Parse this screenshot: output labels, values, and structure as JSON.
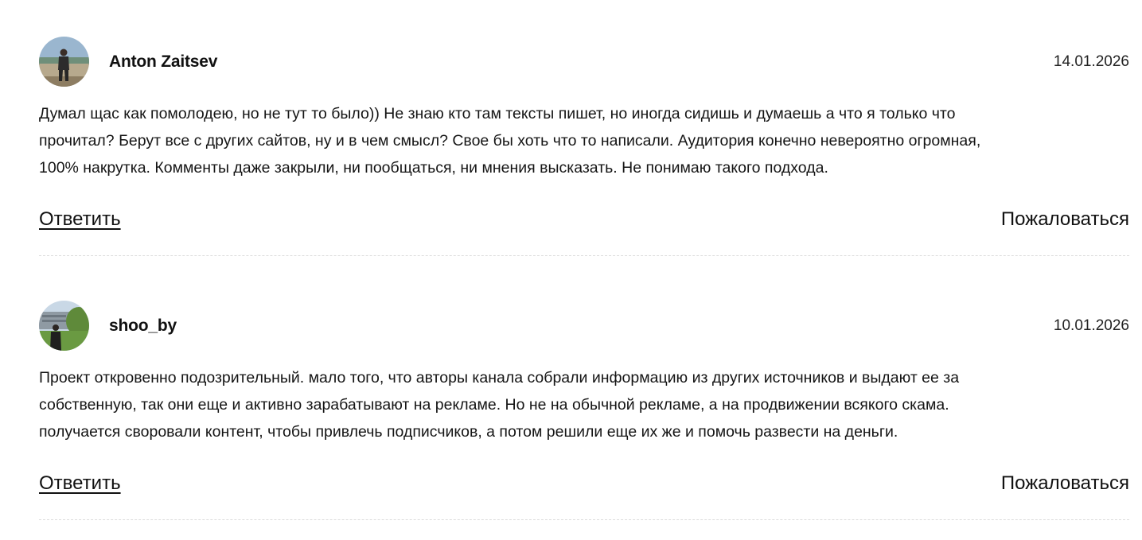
{
  "comments": [
    {
      "author": "Anton Zaitsev",
      "date": "14.01.2026",
      "avatar_icon": "user-photo-avatar",
      "lines": [
        "Думал щас как помолодею, но не тут то было)) Не знаю кто там тексты пишет, но иногда сидишь и думаешь а что я только что",
        "прочитал? Берут все с других сайтов, ну и в чем смысл? Свое бы хоть что то написали. Аудитория конечно невероятно огромная,",
        "100% накрутка. Комменты даже закрыли, ни пообщаться, ни мнения высказать. Не понимаю такого подхода."
      ],
      "reply_label": "Ответить",
      "report_label": "Пожаловаться"
    },
    {
      "author": "shoo_by",
      "date": "10.01.2026",
      "avatar_icon": "user-photo-avatar",
      "lines": [
        "Проект откровенно подозрительный. мало того, что авторы канала собрали информацию из других источников и выдают ее за",
        "собственную, так они еще и активно зарабатывают на рекламе. Но не на обычной рекламе, а на продвижении всякого скама.",
        "получается своровали контент, чтобы привлечь подписчиков, а потом решили еще их же и помочь развести на деньги."
      ],
      "reply_label": "Ответить",
      "report_label": "Пожаловаться"
    }
  ]
}
